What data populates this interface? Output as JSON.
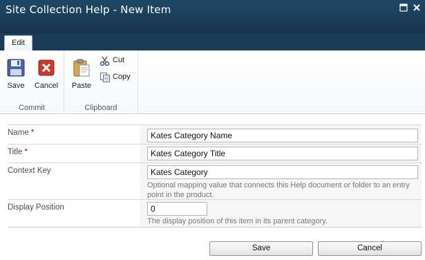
{
  "window": {
    "title": "Site Collection Help - New Item"
  },
  "ribbon": {
    "tabs": [
      {
        "label": "Edit",
        "selected": true
      }
    ],
    "groups": {
      "commit": {
        "label": "Commit",
        "save_label": "Save",
        "cancel_label": "Cancel"
      },
      "clipboard": {
        "label": "Clipboard",
        "paste_label": "Paste",
        "cut_label": "Cut",
        "copy_label": "Copy"
      }
    }
  },
  "form": {
    "required_marker": "*",
    "fields": [
      {
        "label": "Name",
        "required": true,
        "value": "Kates Category Name",
        "help": ""
      },
      {
        "label": "Title",
        "required": true,
        "value": "Kates Category Title",
        "help": ""
      },
      {
        "label": "Context Key",
        "required": false,
        "value": "Kates Category",
        "help": "Optional mapping value that connects this Help document or folder to an entry point in the product."
      },
      {
        "label": "Display Position",
        "required": false,
        "value": "0",
        "help": "The display position of this item in its parent category."
      }
    ]
  },
  "buttons": {
    "save": "Save",
    "cancel": "Cancel"
  },
  "colors": {
    "title_bar": "#1f4866",
    "required": "#bf0000",
    "field_background": "#f6f6f6"
  }
}
